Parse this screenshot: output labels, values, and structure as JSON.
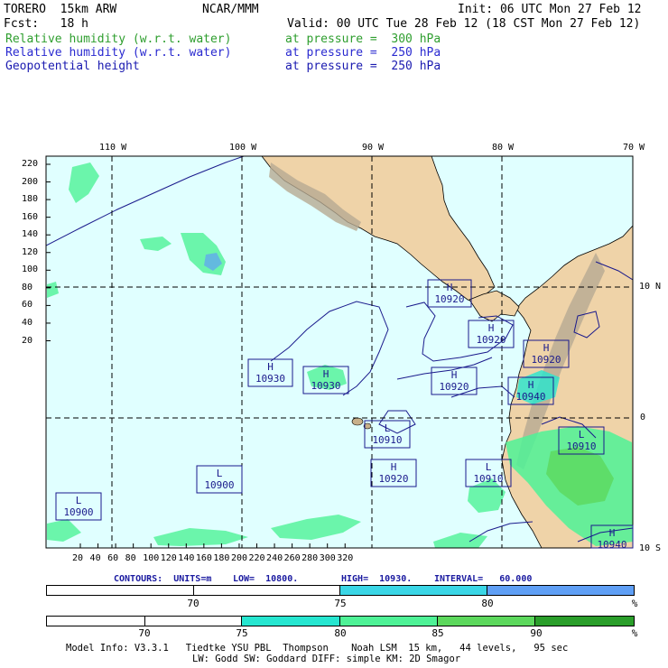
{
  "header": {
    "model": "TORERO  15km ARW",
    "center": "NCAR/MMM",
    "init": "Init: 06 UTC Mon 27 Feb 12",
    "fcst": "Fcst:   18 h",
    "valid": "Valid: 00 UTC Tue 28 Feb 12 (18 CST Mon 27 Feb 12)",
    "fields": [
      {
        "name": "Relative humidity (w.r.t. water)",
        "level": "at pressure =  300 hPa",
        "color": "#2e9e2e"
      },
      {
        "name": "Relative humidity (w.r.t. water)",
        "level": "at pressure =  250 hPa",
        "color": "#2a2ad0"
      },
      {
        "name": "Geopotential height",
        "level": "at pressure =  250 hPa",
        "color": "#1a1ab0"
      }
    ]
  },
  "map": {
    "lon_labels": [
      "110 W",
      "100 W",
      "90 W",
      "80 W",
      "70 W"
    ],
    "lat_labels": [
      "10 N",
      "0",
      "10 S"
    ],
    "y_ticks": [
      "220",
      "200",
      "180",
      "160",
      "140",
      "120",
      "100",
      "80",
      "60",
      "40",
      "20"
    ],
    "x_ticks": [
      "20",
      "40",
      "60",
      "80",
      "100",
      "120",
      "140",
      "160",
      "180",
      "200",
      "220",
      "240",
      "260",
      "280",
      "300",
      "320"
    ],
    "highs_lows": [
      {
        "type": "H",
        "value": "10920"
      },
      {
        "type": "H",
        "value": "10920"
      },
      {
        "type": "H",
        "value": "10920"
      },
      {
        "type": "H",
        "value": "10930"
      },
      {
        "type": "H",
        "value": "10930"
      },
      {
        "type": "H",
        "value": "10920"
      },
      {
        "type": "H",
        "value": "10940"
      },
      {
        "type": "L",
        "value": "10910"
      },
      {
        "type": "L",
        "value": "10910"
      },
      {
        "type": "H",
        "value": "10920"
      },
      {
        "type": "L",
        "value": "10900"
      },
      {
        "type": "L",
        "value": "10900"
      },
      {
        "type": "L",
        "value": "10910"
      },
      {
        "type": "H",
        "value": "10940"
      }
    ],
    "colors": {
      "ocean": "#e0ffff",
      "land": "#efd3a8",
      "grid": "#000000",
      "contour": "#1a1a8c"
    }
  },
  "contour_info": {
    "units": "CONTOURS:  UNITS=m",
    "low": "LOW=  10800.",
    "high": "HIGH=  10930.",
    "interval": "INTERVAL=   60.000"
  },
  "colorbar_250": {
    "labels": [
      "70",
      "75",
      "80"
    ],
    "unit": "%",
    "colors": [
      "#ffffff",
      "#ffffff",
      "#3ad6e6",
      "#5f9ff5"
    ]
  },
  "colorbar_300": {
    "labels": [
      "70",
      "75",
      "80",
      "85",
      "90"
    ],
    "unit": "%",
    "colors": [
      "#ffffff",
      "#ffffff",
      "#26e6d0",
      "#4ef296",
      "#5cd85c",
      "#2a9e2a"
    ]
  },
  "footer": {
    "line1": "Model Info: V3.3.1   Tiedtke YSU PBL  Thompson    Noah LSM  15 km,   44 levels,   95 sec",
    "line2": "LW: Godd SW: Goddard DIFF: simple KM: 2D Smagor"
  }
}
